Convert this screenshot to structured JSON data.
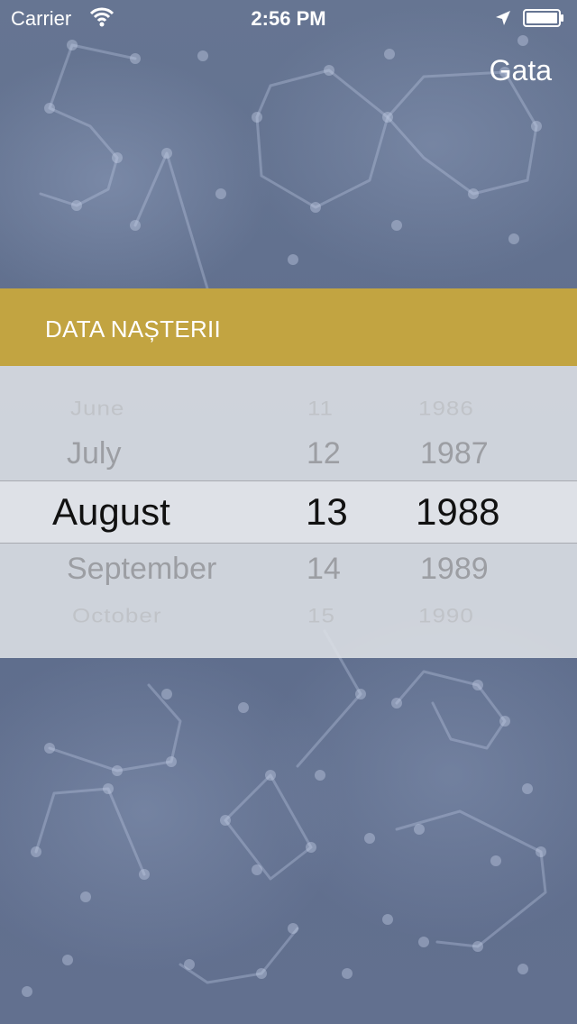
{
  "status_bar": {
    "carrier": "Carrier",
    "time": "2:56 PM",
    "wifi_icon": "wifi-icon",
    "location_icon": "location-arrow-icon",
    "battery_icon": "battery-icon"
  },
  "nav": {
    "done_label": "Gata"
  },
  "section": {
    "title": "DATA NAȘTERII"
  },
  "picker": {
    "months": [
      "June",
      "July",
      "August",
      "September",
      "October"
    ],
    "days": [
      "11",
      "12",
      "13",
      "14",
      "15"
    ],
    "years": [
      "1986",
      "1987",
      "1988",
      "1989",
      "1990"
    ],
    "selected": {
      "month": "August",
      "day": "13",
      "year": "1988"
    }
  },
  "colors": {
    "header_gold": "#c2a441",
    "background_blue": "#62708f",
    "picker_bg": "#dee1e6"
  }
}
